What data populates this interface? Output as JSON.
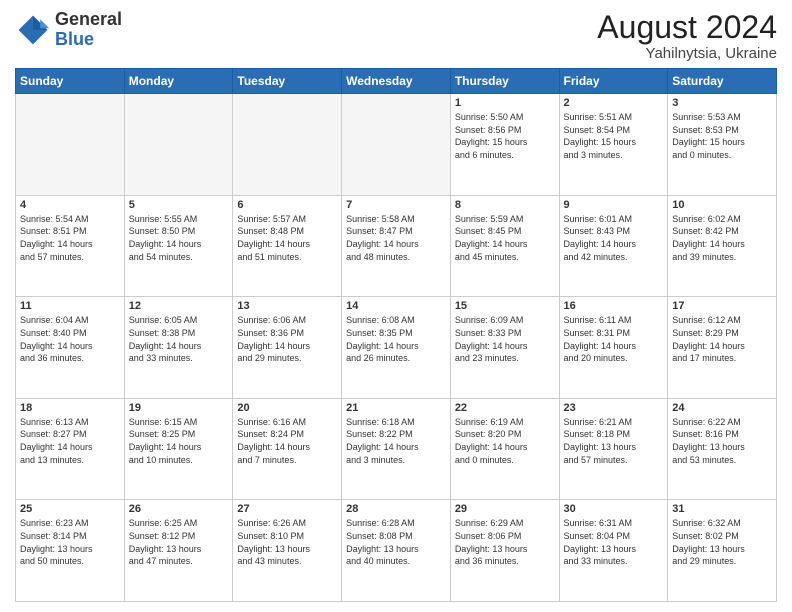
{
  "header": {
    "logo_general": "General",
    "logo_blue": "Blue",
    "title": "August 2024",
    "subtitle": "Yahilnytsia, Ukraine"
  },
  "weekdays": [
    "Sunday",
    "Monday",
    "Tuesday",
    "Wednesday",
    "Thursday",
    "Friday",
    "Saturday"
  ],
  "weeks": [
    [
      {
        "num": "",
        "info": ""
      },
      {
        "num": "",
        "info": ""
      },
      {
        "num": "",
        "info": ""
      },
      {
        "num": "",
        "info": ""
      },
      {
        "num": "1",
        "info": "Sunrise: 5:50 AM\nSunset: 8:56 PM\nDaylight: 15 hours\nand 6 minutes."
      },
      {
        "num": "2",
        "info": "Sunrise: 5:51 AM\nSunset: 8:54 PM\nDaylight: 15 hours\nand 3 minutes."
      },
      {
        "num": "3",
        "info": "Sunrise: 5:53 AM\nSunset: 8:53 PM\nDaylight: 15 hours\nand 0 minutes."
      }
    ],
    [
      {
        "num": "4",
        "info": "Sunrise: 5:54 AM\nSunset: 8:51 PM\nDaylight: 14 hours\nand 57 minutes."
      },
      {
        "num": "5",
        "info": "Sunrise: 5:55 AM\nSunset: 8:50 PM\nDaylight: 14 hours\nand 54 minutes."
      },
      {
        "num": "6",
        "info": "Sunrise: 5:57 AM\nSunset: 8:48 PM\nDaylight: 14 hours\nand 51 minutes."
      },
      {
        "num": "7",
        "info": "Sunrise: 5:58 AM\nSunset: 8:47 PM\nDaylight: 14 hours\nand 48 minutes."
      },
      {
        "num": "8",
        "info": "Sunrise: 5:59 AM\nSunset: 8:45 PM\nDaylight: 14 hours\nand 45 minutes."
      },
      {
        "num": "9",
        "info": "Sunrise: 6:01 AM\nSunset: 8:43 PM\nDaylight: 14 hours\nand 42 minutes."
      },
      {
        "num": "10",
        "info": "Sunrise: 6:02 AM\nSunset: 8:42 PM\nDaylight: 14 hours\nand 39 minutes."
      }
    ],
    [
      {
        "num": "11",
        "info": "Sunrise: 6:04 AM\nSunset: 8:40 PM\nDaylight: 14 hours\nand 36 minutes."
      },
      {
        "num": "12",
        "info": "Sunrise: 6:05 AM\nSunset: 8:38 PM\nDaylight: 14 hours\nand 33 minutes."
      },
      {
        "num": "13",
        "info": "Sunrise: 6:06 AM\nSunset: 8:36 PM\nDaylight: 14 hours\nand 29 minutes."
      },
      {
        "num": "14",
        "info": "Sunrise: 6:08 AM\nSunset: 8:35 PM\nDaylight: 14 hours\nand 26 minutes."
      },
      {
        "num": "15",
        "info": "Sunrise: 6:09 AM\nSunset: 8:33 PM\nDaylight: 14 hours\nand 23 minutes."
      },
      {
        "num": "16",
        "info": "Sunrise: 6:11 AM\nSunset: 8:31 PM\nDaylight: 14 hours\nand 20 minutes."
      },
      {
        "num": "17",
        "info": "Sunrise: 6:12 AM\nSunset: 8:29 PM\nDaylight: 14 hours\nand 17 minutes."
      }
    ],
    [
      {
        "num": "18",
        "info": "Sunrise: 6:13 AM\nSunset: 8:27 PM\nDaylight: 14 hours\nand 13 minutes."
      },
      {
        "num": "19",
        "info": "Sunrise: 6:15 AM\nSunset: 8:25 PM\nDaylight: 14 hours\nand 10 minutes."
      },
      {
        "num": "20",
        "info": "Sunrise: 6:16 AM\nSunset: 8:24 PM\nDaylight: 14 hours\nand 7 minutes."
      },
      {
        "num": "21",
        "info": "Sunrise: 6:18 AM\nSunset: 8:22 PM\nDaylight: 14 hours\nand 3 minutes."
      },
      {
        "num": "22",
        "info": "Sunrise: 6:19 AM\nSunset: 8:20 PM\nDaylight: 14 hours\nand 0 minutes."
      },
      {
        "num": "23",
        "info": "Sunrise: 6:21 AM\nSunset: 8:18 PM\nDaylight: 13 hours\nand 57 minutes."
      },
      {
        "num": "24",
        "info": "Sunrise: 6:22 AM\nSunset: 8:16 PM\nDaylight: 13 hours\nand 53 minutes."
      }
    ],
    [
      {
        "num": "25",
        "info": "Sunrise: 6:23 AM\nSunset: 8:14 PM\nDaylight: 13 hours\nand 50 minutes."
      },
      {
        "num": "26",
        "info": "Sunrise: 6:25 AM\nSunset: 8:12 PM\nDaylight: 13 hours\nand 47 minutes."
      },
      {
        "num": "27",
        "info": "Sunrise: 6:26 AM\nSunset: 8:10 PM\nDaylight: 13 hours\nand 43 minutes."
      },
      {
        "num": "28",
        "info": "Sunrise: 6:28 AM\nSunset: 8:08 PM\nDaylight: 13 hours\nand 40 minutes."
      },
      {
        "num": "29",
        "info": "Sunrise: 6:29 AM\nSunset: 8:06 PM\nDaylight: 13 hours\nand 36 minutes."
      },
      {
        "num": "30",
        "info": "Sunrise: 6:31 AM\nSunset: 8:04 PM\nDaylight: 13 hours\nand 33 minutes."
      },
      {
        "num": "31",
        "info": "Sunrise: 6:32 AM\nSunset: 8:02 PM\nDaylight: 13 hours\nand 29 minutes."
      }
    ]
  ]
}
